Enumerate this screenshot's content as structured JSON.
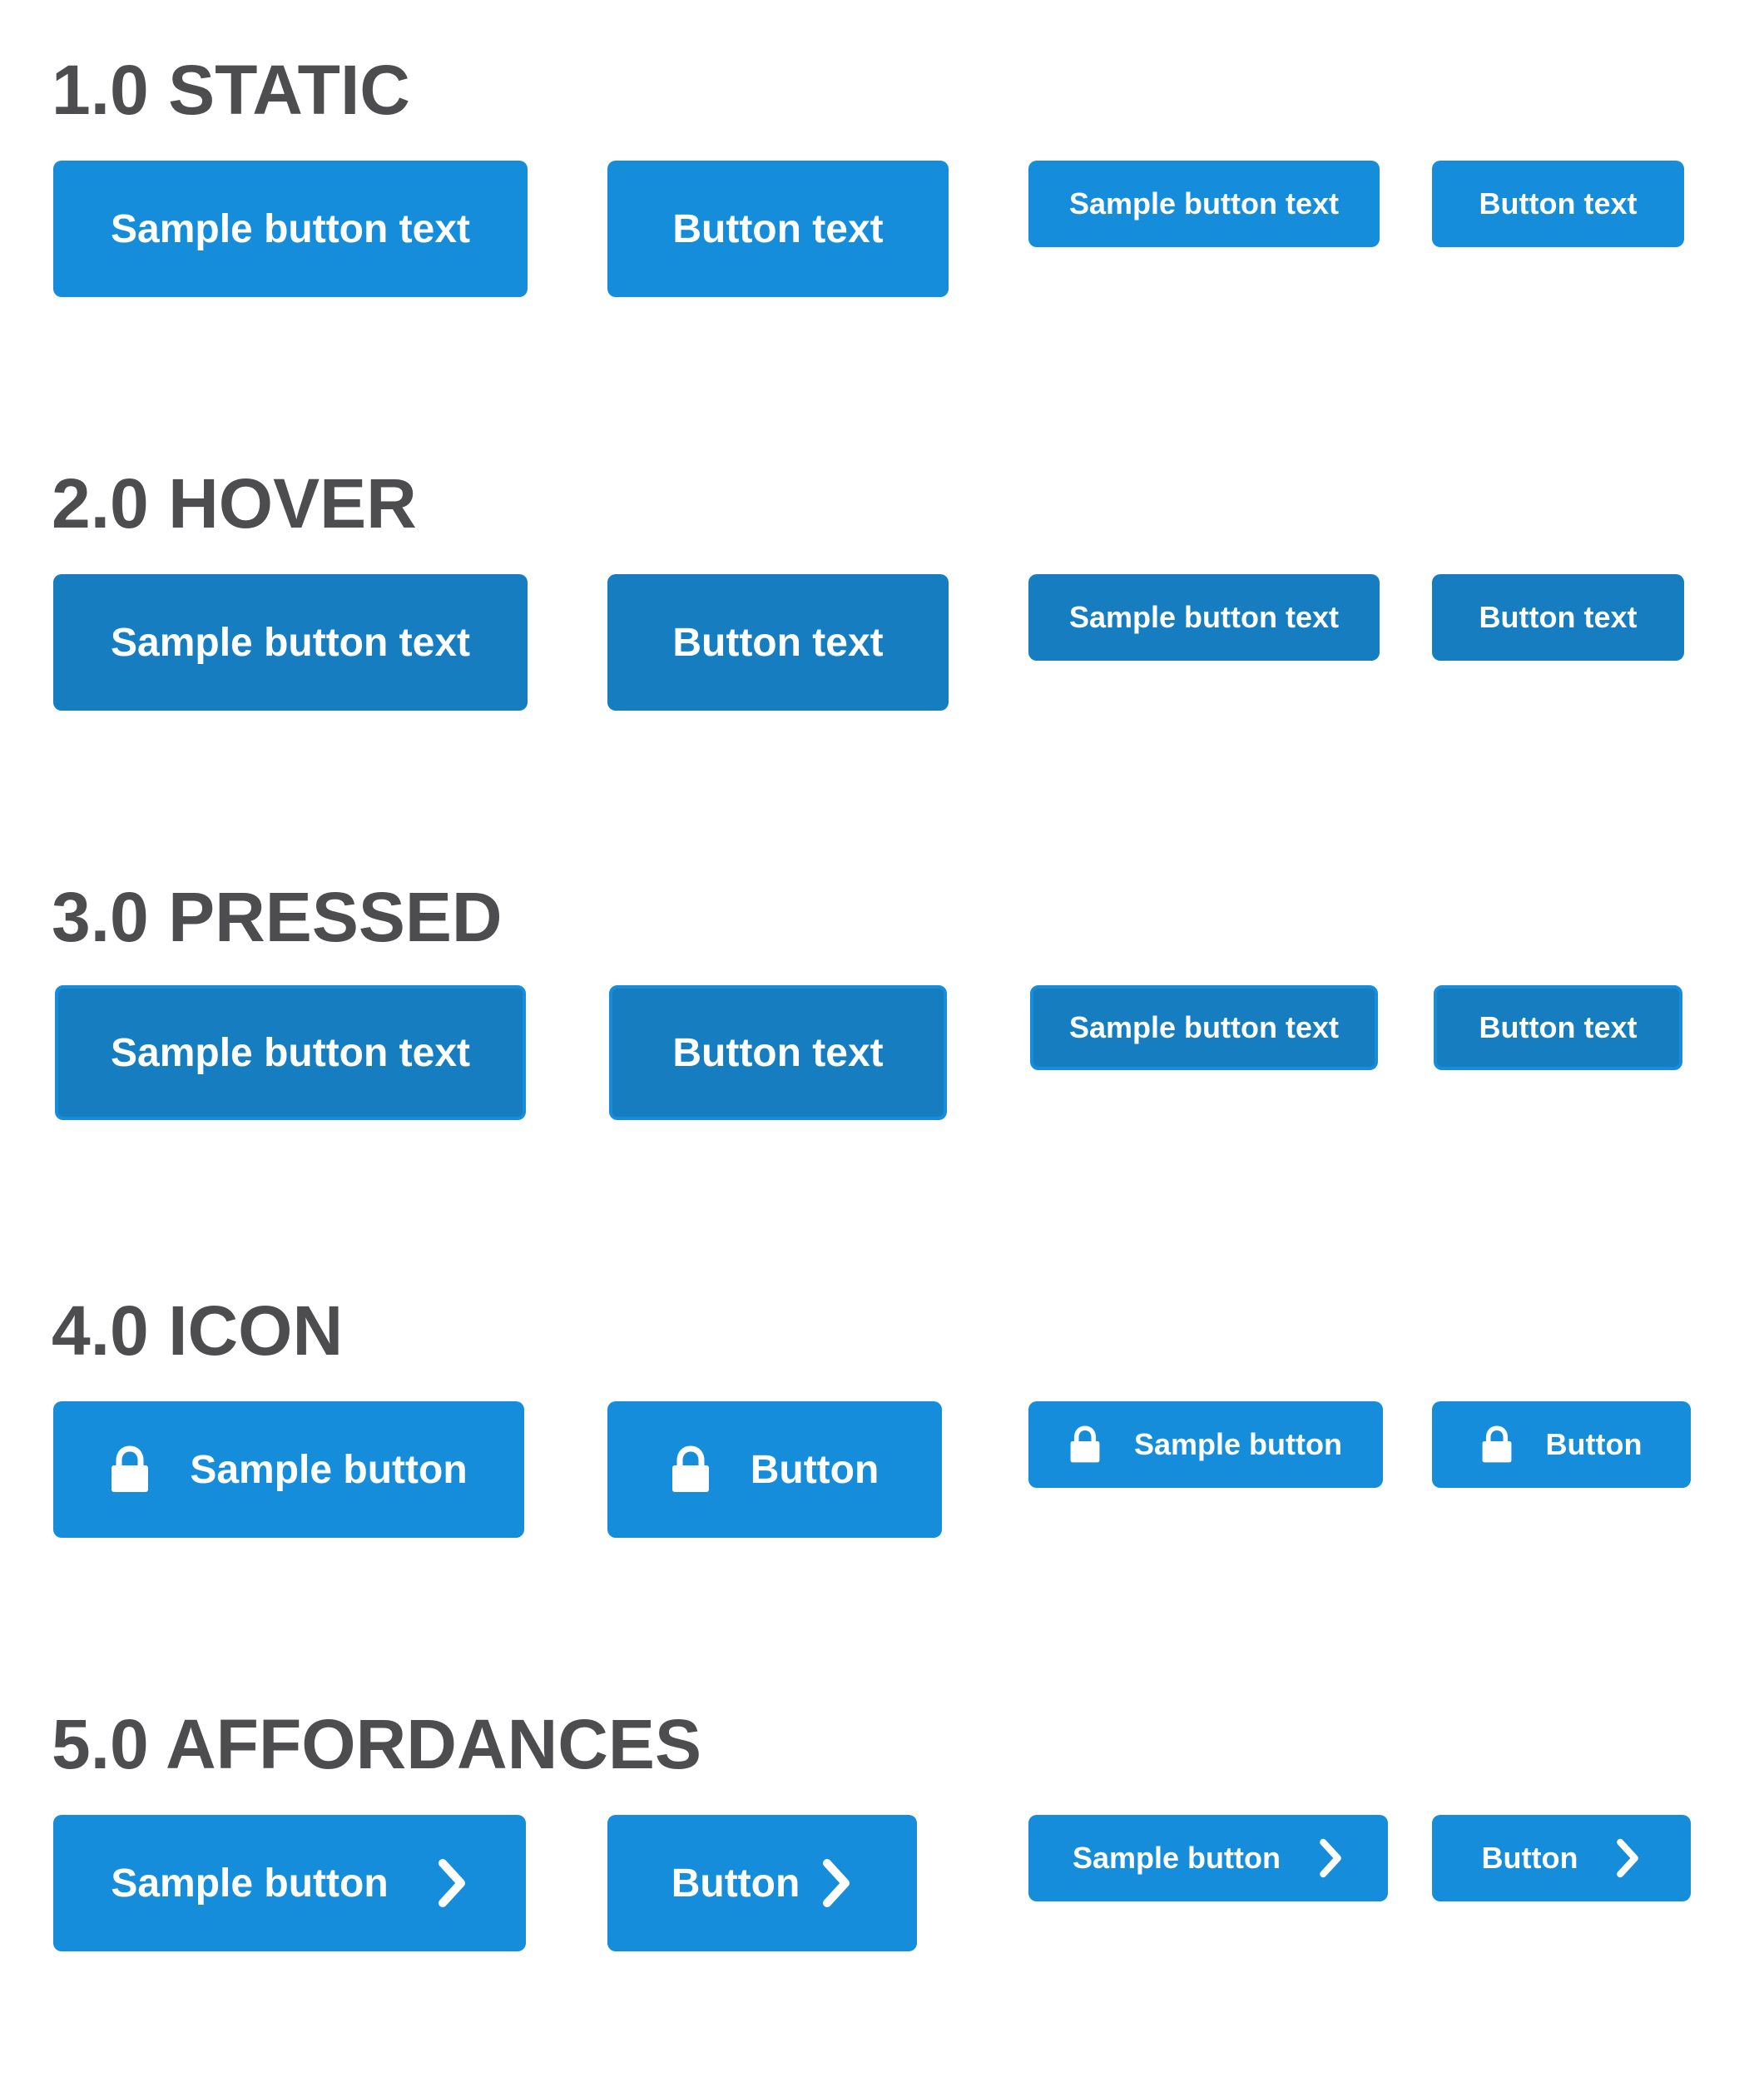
{
  "sections": [
    {
      "title": "1.0 STATIC",
      "buttons": [
        {
          "label": "Sample button text"
        },
        {
          "label": "Button text"
        },
        {
          "label": "Sample button text"
        },
        {
          "label": "Button text"
        }
      ]
    },
    {
      "title": "2.0 HOVER",
      "buttons": [
        {
          "label": "Sample button text"
        },
        {
          "label": "Button text"
        },
        {
          "label": "Sample button text"
        },
        {
          "label": "Button text"
        }
      ]
    },
    {
      "title": "3.0 PRESSED",
      "buttons": [
        {
          "label": "Sample button text"
        },
        {
          "label": "Button text"
        },
        {
          "label": "Sample button text"
        },
        {
          "label": "Button text"
        }
      ]
    },
    {
      "title": "4.0 ICON",
      "buttons": [
        {
          "label": "Sample button",
          "icon": "lock-icon"
        },
        {
          "label": "Button",
          "icon": "lock-icon"
        },
        {
          "label": "Sample button",
          "icon": "lock-icon"
        },
        {
          "label": "Button",
          "icon": "lock-icon"
        }
      ]
    },
    {
      "title": "5.0 AFFORDANCES",
      "buttons": [
        {
          "label": "Sample button",
          "icon": "chevron-right-icon"
        },
        {
          "label": "Button",
          "icon": "chevron-right-icon"
        },
        {
          "label": "Sample button",
          "icon": "chevron-right-icon"
        },
        {
          "label": "Button",
          "icon": "chevron-right-icon"
        }
      ]
    }
  ],
  "colors": {
    "primary": "#168ddb",
    "hover": "#157dc0",
    "pressed": "#157dc0",
    "heading": "#4d4d4f",
    "button_text": "#ffffff"
  }
}
